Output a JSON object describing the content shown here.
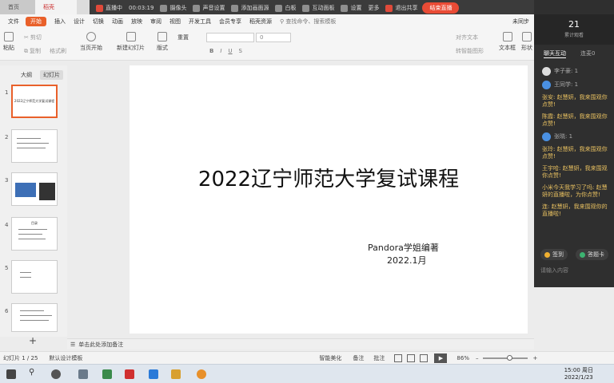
{
  "tabs": {
    "home": "首页",
    "doc": "稻壳"
  },
  "live": {
    "status": "直播中",
    "time": "00:03:19",
    "items": [
      "摄像头",
      "声音设置",
      "添加画面源",
      "白板",
      "互动面板",
      "设置",
      "更多"
    ],
    "exit_share": "退出共享",
    "stop_button": "结束直播"
  },
  "menu": {
    "file": "文件",
    "items": [
      "开始",
      "插入",
      "设计",
      "切换",
      "动画",
      "放映",
      "审阅",
      "视图",
      "开发工具",
      "会员专享",
      "稻壳资源"
    ],
    "search": "查找命令、搜索模板",
    "sync": "未同步",
    "active": "开始"
  },
  "ribbon": {
    "paste": "粘贴",
    "cut": "剪切",
    "copy": "复制",
    "format_painter": "格式刷",
    "from_current": "当页开始",
    "new_slide": "新建幻灯片",
    "layout": "版式",
    "reset": "重置",
    "font_size": "0",
    "align_text": "对齐文本",
    "smart_shape": "转智能图形",
    "textbox": "文本框",
    "shape": "形状"
  },
  "left_panel": {
    "tab_outline": "大纲",
    "tab_slides": "幻灯片",
    "slide_numbers": [
      "1",
      "2",
      "3",
      "4",
      "5",
      "6"
    ],
    "thumb1_text": "2022辽宁师范大学复试课程",
    "thumb4_text": "目录"
  },
  "slide": {
    "title": "2022辽宁师范大学复试课程",
    "author": "Pandora学姐编著",
    "date": "2022.1月"
  },
  "notes": {
    "placeholder": "单击此处添加备注"
  },
  "status": {
    "slide_counter": "幻灯片 1 / 25",
    "template": "默认设计模板",
    "smart_beautify": "智能美化",
    "notes": "备注",
    "annotate": "批注",
    "zoom": "86%"
  },
  "chat": {
    "viewer_count": "21",
    "viewer_label": "累计观看",
    "tab_active": "聊天互动",
    "tab_other": "连麦0",
    "messages": [
      {
        "type": "user",
        "text": "李子豪: 1"
      },
      {
        "type": "user",
        "text": "王同学: 1"
      },
      {
        "type": "gift",
        "text": "张安: 赵慧妍，我来围观你点赞!"
      },
      {
        "type": "gift",
        "text": "陈霞: 赵慧妍，我来围观你点赞!"
      },
      {
        "type": "user",
        "text": "张晓: 1"
      },
      {
        "type": "gift",
        "text": "张玲: 赵慧妍，我来围观你点赞!"
      },
      {
        "type": "gift",
        "text": "王宇哈: 赵慧妍，我来围观你点赞!"
      },
      {
        "type": "gift",
        "text": "小米今天我学习了吗: 赵慧妍的直播啦，为你点赞!"
      },
      {
        "type": "gift",
        "text": "连: 赵慧妍，我来围观你的直播啦!"
      }
    ],
    "btn_signin": "签到",
    "btn_answer": "答题卡",
    "input_placeholder": "请输入内容"
  },
  "taskbar": {
    "time": "15:00 周日",
    "date": "2022/1/23"
  }
}
